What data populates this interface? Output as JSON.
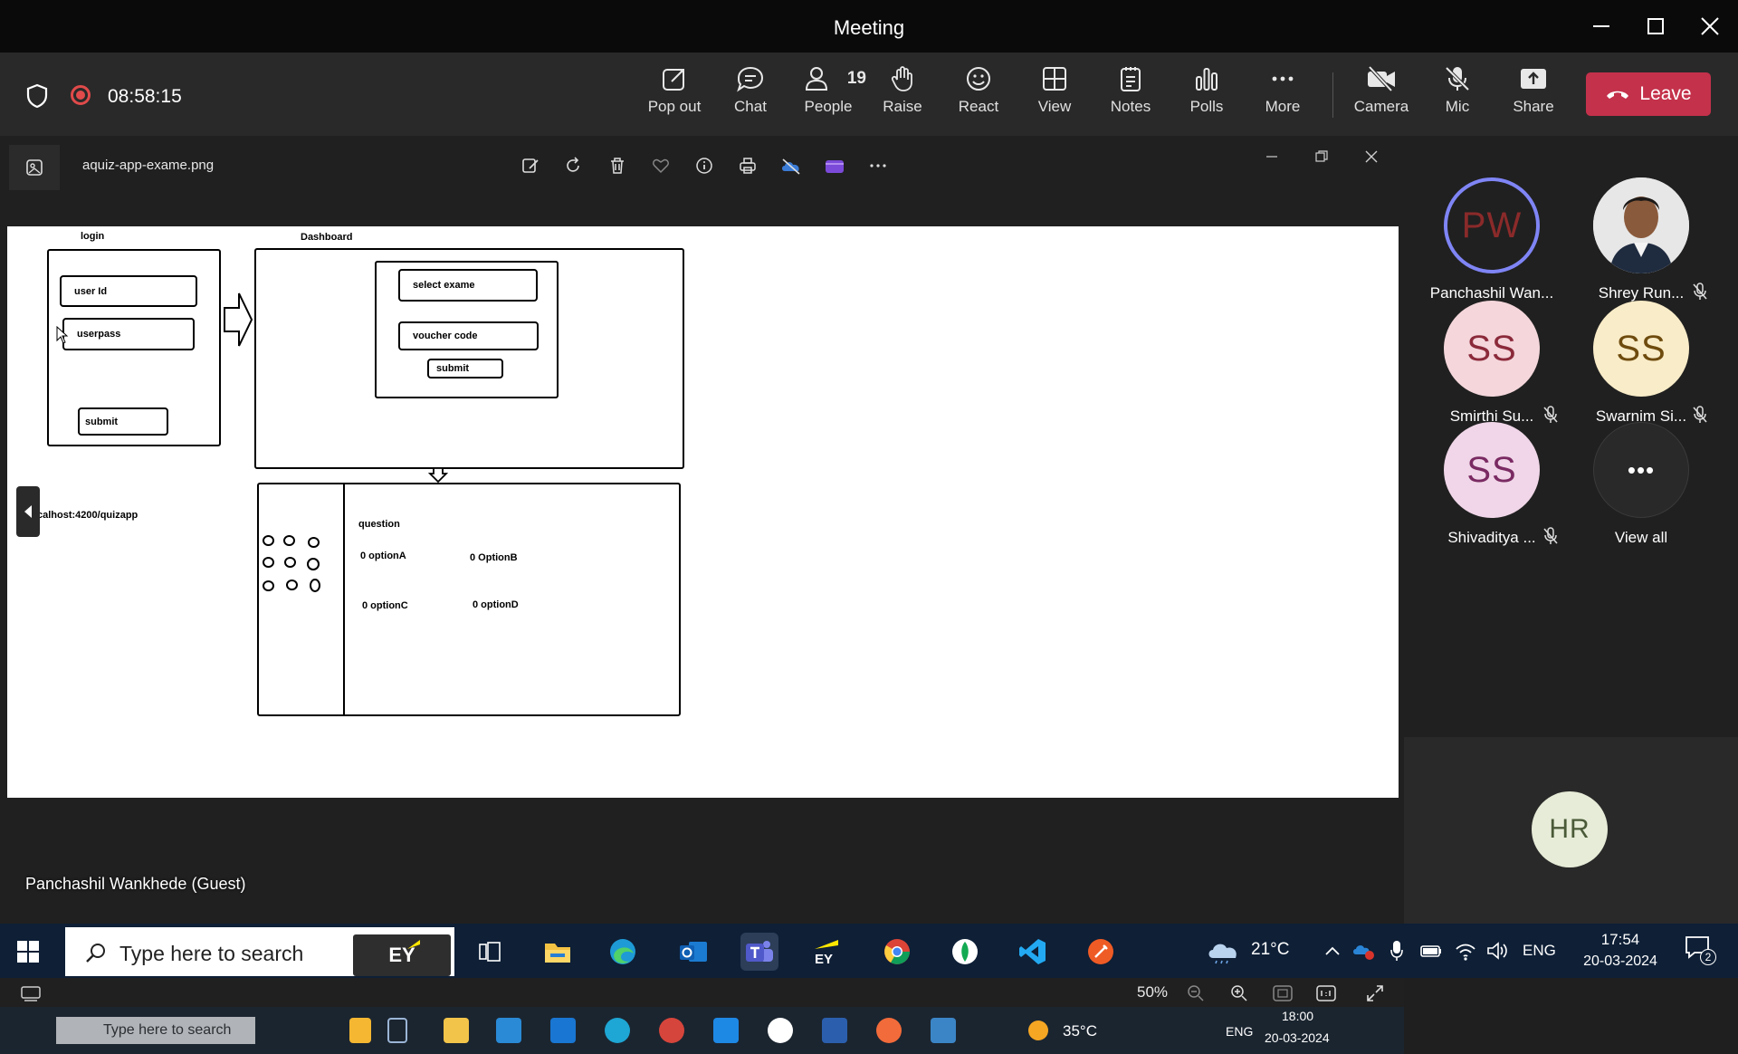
{
  "window": {
    "title": "Meeting"
  },
  "toolbar": {
    "timer": "08:58:15",
    "people_count": "19",
    "items": {
      "popout": "Pop out",
      "chat": "Chat",
      "people": "People",
      "raise": "Raise",
      "react": "React",
      "view": "View",
      "notes": "Notes",
      "polls": "Polls",
      "more": "More",
      "camera": "Camera",
      "mic": "Mic",
      "share": "Share"
    },
    "leave_label": "Leave",
    "colors": {
      "leave": "#c4314b",
      "record": "#e04a4a"
    }
  },
  "viewer": {
    "filename": "aquiz-app-exame.png",
    "zoom": "50%"
  },
  "diagram": {
    "login_title": "login",
    "user_id": "user Id",
    "userpass": "userpass",
    "submit_login": "submit",
    "dashboard_title": "Dashboard",
    "select_exame": "select exame",
    "voucher_code": "voucher code",
    "submit_dashboard": "submit",
    "url_label": "calhost:4200/quizapp",
    "question": "question",
    "option_a": "0 optionA",
    "option_b": "0 OptionB",
    "option_c": "0 optionC",
    "option_d": "0 optionD"
  },
  "shared_screen": {
    "presenter": "Panchashil Wankhede (Guest)",
    "search_placeholder": "Type here to search",
    "temperature": "35°C",
    "lang": "ENG",
    "time": "18:00",
    "date": "20-03-2024"
  },
  "participants": [
    {
      "initials": "PW",
      "name": "Panchashil Wan...",
      "color": "#f7d9d5",
      "text_color": "#8b2a2a",
      "muted": false,
      "speaking": true
    },
    {
      "initials": "",
      "name": "Shrey Run...",
      "photo": true,
      "muted": true
    },
    {
      "initials": "SS",
      "name": "Smirthi Su...",
      "color": "#f4d6db",
      "text_color": "#8b2a3a",
      "muted": true
    },
    {
      "initials": "SS",
      "name": "Swarnim Si...",
      "color": "#f9ecc8",
      "text_color": "#6e4b0e",
      "muted": true
    },
    {
      "initials": "SS",
      "name": "Shivaditya ...",
      "color": "#f0d6e8",
      "text_color": "#7a2a62",
      "muted": true
    },
    {
      "initials": "•••",
      "name": "View all",
      "color": "#292929",
      "text_color": "#ffffff",
      "muted": false
    }
  ],
  "bottom_tile": {
    "initials": "HR",
    "color": "#e6ecd7",
    "text_color": "#4a5a38"
  },
  "taskbar": {
    "search_placeholder": "Type here to search",
    "ey": "EY",
    "weather": "21°C",
    "lang": "ENG",
    "time": "17:54",
    "date": "20-03-2024",
    "notif_count": "2"
  }
}
